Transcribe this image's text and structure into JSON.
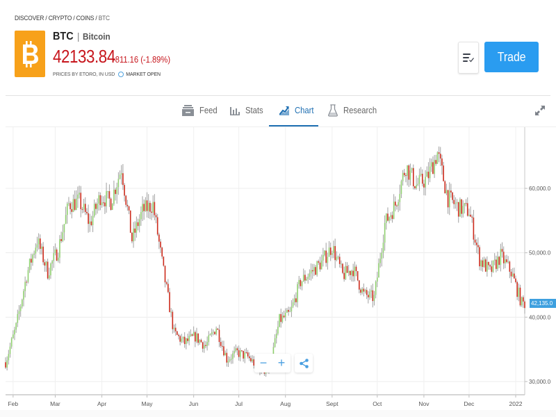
{
  "breadcrumb": {
    "items": [
      "DISCOVER",
      "CRYPTO",
      "COINS",
      "BTC"
    ],
    "separator": " / "
  },
  "instrument": {
    "symbol": "BTC",
    "name": "Bitcoin",
    "separator": "|",
    "price": "42133.84",
    "change": "-811.16 (-1.89%)",
    "prices_source": "PRICES BY ETORO, IN USD",
    "market_status": "MARKET OPEN",
    "logo_icon": "bitcoin-logo-icon",
    "logo_color": "#f7a11a",
    "price_color": "#c7161d"
  },
  "actions": {
    "watchlist_icon": "watchlist-icon",
    "trade_label": "Trade",
    "trade_color": "#2a9cf0"
  },
  "tabs": [
    {
      "label": "Feed",
      "icon": "feed-icon",
      "active": false
    },
    {
      "label": "Stats",
      "icon": "stats-icon",
      "active": false
    },
    {
      "label": "Chart",
      "icon": "chart-icon",
      "active": true
    },
    {
      "label": "Research",
      "icon": "research-icon",
      "active": false
    }
  ],
  "expand_icon": "expand-icon",
  "chart_controls": {
    "zoom_out": "−",
    "zoom_in": "+",
    "share_icon": "share-icon"
  },
  "chart_data": {
    "type": "candlestick",
    "title": "",
    "xlabel": "",
    "ylabel": "",
    "x_tick_labels": [
      "Feb",
      "Mar",
      "Apr",
      "May",
      "Jun",
      "Jul",
      "Aug",
      "Sept",
      "Oct",
      "Nov",
      "Dec",
      "2022"
    ],
    "y_tick_labels": [
      "60,000.0",
      "50,000.0",
      "40,000.0",
      "30,000.0"
    ],
    "y_ticks": [
      60000,
      50000,
      40000,
      30000
    ],
    "ylim": [
      27950,
      69500
    ],
    "x_range": [
      "2021-01-27",
      "2022-01-07"
    ],
    "current_price_label": "42,135.0",
    "current_price": 42135,
    "up_color": "#8fcf6f",
    "down_color": "#cc2a1b",
    "wick_color": "#a0a0a0",
    "grid": true,
    "legend": "none",
    "closes_weekly": [
      {
        "week": "2021-01-27",
        "close": 33000
      },
      {
        "week": "2021-02-03",
        "close": 38500
      },
      {
        "week": "2021-02-10",
        "close": 46500
      },
      {
        "week": "2021-02-17",
        "close": 52000
      },
      {
        "week": "2021-02-24",
        "close": 47000
      },
      {
        "week": "2021-03-03",
        "close": 50500
      },
      {
        "week": "2021-03-10",
        "close": 57500
      },
      {
        "week": "2021-03-17",
        "close": 58000
      },
      {
        "week": "2021-03-24",
        "close": 54500
      },
      {
        "week": "2021-03-31",
        "close": 58800
      },
      {
        "week": "2021-04-07",
        "close": 58000
      },
      {
        "week": "2021-04-14",
        "close": 63200
      },
      {
        "week": "2021-04-21",
        "close": 52000
      },
      {
        "week": "2021-04-28",
        "close": 56500
      },
      {
        "week": "2021-05-05",
        "close": 57500
      },
      {
        "week": "2021-05-12",
        "close": 47000
      },
      {
        "week": "2021-05-19",
        "close": 37500
      },
      {
        "week": "2021-05-26",
        "close": 36000
      },
      {
        "week": "2021-06-02",
        "close": 37000
      },
      {
        "week": "2021-06-09",
        "close": 35500
      },
      {
        "week": "2021-06-16",
        "close": 38500
      },
      {
        "week": "2021-06-23",
        "close": 33500
      },
      {
        "week": "2021-06-30",
        "close": 34500
      },
      {
        "week": "2021-07-07",
        "close": 33800
      },
      {
        "week": "2021-07-14",
        "close": 32200
      },
      {
        "week": "2021-07-21",
        "close": 31500
      },
      {
        "week": "2021-07-28",
        "close": 39500
      },
      {
        "week": "2021-08-04",
        "close": 40500
      },
      {
        "week": "2021-08-11",
        "close": 45500
      },
      {
        "week": "2021-08-18",
        "close": 47000
      },
      {
        "week": "2021-08-25",
        "close": 48500
      },
      {
        "week": "2021-09-01",
        "close": 51000
      },
      {
        "week": "2021-09-08",
        "close": 46500
      },
      {
        "week": "2021-09-15",
        "close": 47500
      },
      {
        "week": "2021-09-22",
        "close": 43500
      },
      {
        "week": "2021-09-29",
        "close": 43000
      },
      {
        "week": "2021-10-06",
        "close": 54500
      },
      {
        "week": "2021-10-13",
        "close": 57500
      },
      {
        "week": "2021-10-20",
        "close": 63500
      },
      {
        "week": "2021-10-27",
        "close": 60500
      },
      {
        "week": "2021-11-03",
        "close": 61500
      },
      {
        "week": "2021-11-10",
        "close": 65500
      },
      {
        "week": "2021-11-17",
        "close": 58500
      },
      {
        "week": "2021-11-24",
        "close": 57000
      },
      {
        "week": "2021-12-01",
        "close": 56500
      },
      {
        "week": "2021-12-08",
        "close": 49000
      },
      {
        "week": "2021-12-15",
        "close": 47000
      },
      {
        "week": "2021-12-22",
        "close": 49500
      },
      {
        "week": "2021-12-29",
        "close": 47000
      },
      {
        "week": "2022-01-05",
        "close": 42135
      }
    ]
  }
}
